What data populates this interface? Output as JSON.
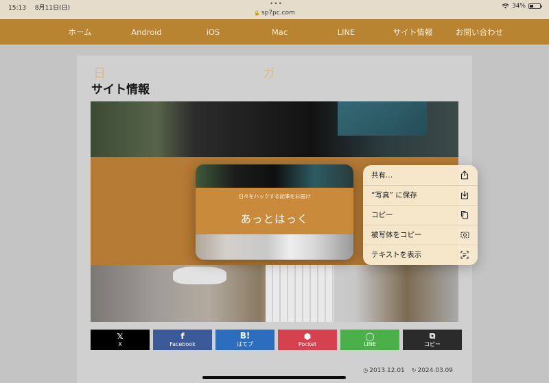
{
  "status_bar": {
    "time": "15:13",
    "date": "8月11日(日)",
    "url": "sp7pc.com",
    "battery": "34%"
  },
  "nav": {
    "items": [
      "ホーム",
      "Android",
      "iOS",
      "Mac",
      "LINE",
      "サイト情報",
      "お問い合わせ"
    ]
  },
  "page": {
    "title": "サイト情報"
  },
  "hero": {
    "ghost_left": "日",
    "ghost_right": "ガ"
  },
  "preview": {
    "subtitle": "日々をハックする記事をお届け",
    "title": "あっとはっく"
  },
  "context_menu": {
    "items": [
      {
        "label": "共有...",
        "icon": "share-icon"
      },
      {
        "label": "“写真” に保存",
        "icon": "save-download-icon"
      },
      {
        "label": "コピー",
        "icon": "copy-icon"
      },
      {
        "label": "被写体をコピー",
        "icon": "subject-copy-icon"
      },
      {
        "label": "テキストを表示",
        "icon": "show-text-icon"
      }
    ]
  },
  "share_buttons": [
    {
      "label": "X",
      "glyph": "𝕏",
      "color": "#000000"
    },
    {
      "label": "Facebook",
      "glyph": "f",
      "color": "#3b5998"
    },
    {
      "label": "はてブ",
      "glyph": "B!",
      "color": "#2c6ebd"
    },
    {
      "label": "Pocket",
      "glyph": "⬢",
      "color": "#d5414f"
    },
    {
      "label": "LINE",
      "glyph": "◯",
      "color": "#4cb04a"
    },
    {
      "label": "コピー",
      "glyph": "⧉",
      "color": "#2b2b2b"
    }
  ],
  "dates": {
    "published": "2013.12.01",
    "updated": "2024.03.09"
  },
  "colors": {
    "nav_bg": "#b98432",
    "brand_band": "#c98a3c"
  }
}
